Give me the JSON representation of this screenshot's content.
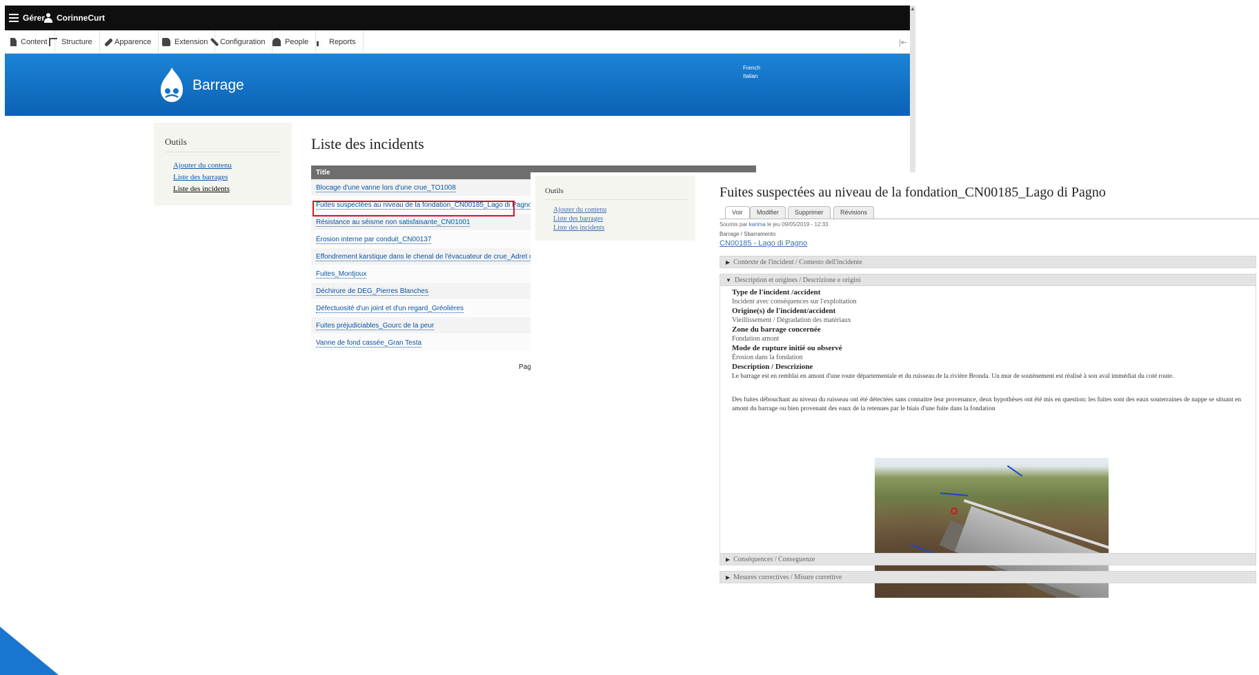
{
  "toolbar": {
    "manage_label": "Gérer",
    "user_label": "CorinneCurt"
  },
  "menu": {
    "items": [
      {
        "label": "Content"
      },
      {
        "label": "Structure"
      },
      {
        "label": "Apparence"
      },
      {
        "label": "Extension"
      },
      {
        "label": "Configuration"
      },
      {
        "label": "People"
      },
      {
        "label": "Reports"
      }
    ]
  },
  "header": {
    "site_name": "Barrage",
    "languages": [
      "French",
      "Italian"
    ]
  },
  "sidebar": {
    "title": "Outils",
    "links": [
      "Ajouter du contenu",
      "Liste des barrages",
      "Liste des incidents"
    ]
  },
  "incident_list": {
    "title": "Liste des incidents",
    "column_title": "Title",
    "rows": [
      "Blocage d'une vanne lors d'une crue_TO1008",
      "Fuites suspectées au niveau de la fondation_CN00185_Lago di Pagno",
      "Résistance au séisme non satisfaisante_CN01001",
      "Érosion interne par conduit_CN00137",
      "Effondrement karstique dans le chenal de l'évacuateur de crue_Adret des Tuff",
      "Fuites_Montjoux",
      "Déchirure de DEG_Pierres Blanches",
      "Défectuosité d'un joint et d'un regard_Gréolières",
      "Fuites préjudiciables_Gourc de la peur",
      "Vanne de fond cassée_Gran Testa"
    ],
    "pager": "Pag"
  },
  "detail": {
    "sidebar_title": "Outils",
    "sidebar_links": [
      "Ajouter du contenu",
      "Liste des barrages",
      "Liste des incidents"
    ],
    "title": "Fuites suspectées au niveau de la fondation_CN00185_Lago di Pagno",
    "tabs": [
      "Voir",
      "Modifier",
      "Supprimer",
      "Révisions"
    ],
    "submitted_prefix": "Soumis par",
    "submitted_user": "karima",
    "submitted_suffix": "le jeu 09/05/2019 - 12:33",
    "barrage_label": "Barrage / Sbarramento",
    "barrage_link": "CN00185 - Lago di Pagno",
    "sections": {
      "contexte": "Contexte de l'incident / Contesto dell'incidente",
      "description": "Description et origines / Descrizione e origini",
      "consequences": "Conséquences / Conseguenze",
      "mesures": "Mesures correctives / Misure correttive"
    },
    "fields": {
      "type_label": "Type de l'incident /accident",
      "type_value": "Incident avec conséquences sur l'exploitation",
      "origine_label": "Origine(s) de l'incident/accident",
      "origine_value": "Vieillissement / Dégradation des matériaux",
      "zone_label": "Zone du barrage concernée",
      "zone_value": "Fondation amont",
      "mode_label": "Mode de rupture initié ou observé",
      "mode_value": "Érosion dans la fondation",
      "desc_label": "Description / Descrizione",
      "para1": "Le barrage est en remblai en amont d'une route départementale et du ruisseau de la rivière Bronda. Un mur de soutènement est réalisé à son aval immédiat du coté route.",
      "para2": "Des fuites débouchant au niveau du ruisseau ont été détectées sans connaitre leur provenance, deux hypothèses ont été mis en question: les fuites sont des eaux souterraines de nappe se situant en amont du barrage ou bien provenant des eaux de la retenues par le biais d'une fuite dans la fondation"
    }
  },
  "colors": {
    "toolbar_bg": "#0f0f0f",
    "header_blue": "#1473c7",
    "link_blue": "#0a55a2",
    "highlight_red": "#e01020",
    "table_header": "#6e6e6e"
  }
}
